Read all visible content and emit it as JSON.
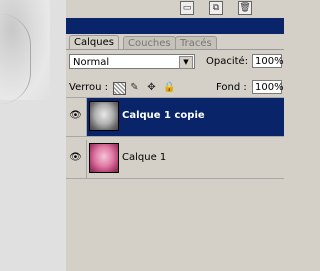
{
  "panel": {
    "tabs": [
      {
        "label": "Calques",
        "active": true
      },
      {
        "label": "Couches",
        "active": false
      },
      {
        "label": "Tracés",
        "active": false
      }
    ],
    "blend_mode": "Normal",
    "opacity_label": "Opacité:",
    "opacity_value": "100%",
    "lock_label": "Verrou :",
    "fill_label": "Fond :",
    "fill_value": "100%"
  },
  "layers": [
    {
      "name": "Calque 1 copie",
      "selected": true,
      "visible": true
    },
    {
      "name": "Calque 1",
      "selected": false,
      "visible": true
    }
  ],
  "icons": {
    "top": [
      "document-icon",
      "new-file-icon",
      "trash-icon"
    ],
    "lock": [
      "lock-transparency-icon",
      "lock-paint-icon",
      "lock-move-icon",
      "lock-all-icon"
    ]
  }
}
